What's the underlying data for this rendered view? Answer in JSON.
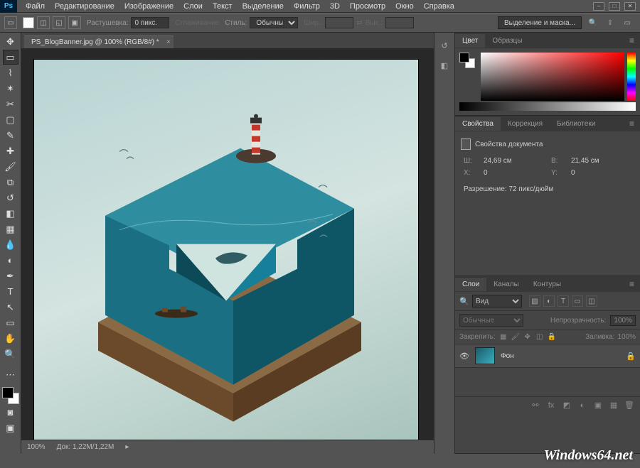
{
  "app": {
    "logo": "Ps"
  },
  "menu": [
    "Файл",
    "Редактирование",
    "Изображение",
    "Слои",
    "Текст",
    "Выделение",
    "Фильтр",
    "3D",
    "Просмотр",
    "Окно",
    "Справка"
  ],
  "window_ctrls": {
    "min": "–",
    "max": "□",
    "close": "✕"
  },
  "options": {
    "feather_label": "Растушевка:",
    "feather_value": "0 пикс.",
    "antialias_label": "Сглаживание",
    "style_label": "Стиль:",
    "style_value": "Обычный",
    "width_label": "Шир.:",
    "height_label": "Выс.:",
    "select_mask": "Выделение и маска..."
  },
  "document": {
    "tab_title": "PS_BlogBanner.jpg @ 100% (RGB/8#) *",
    "zoom": "100%",
    "doc_size": "Док: 1,22M/1,22M"
  },
  "panels": {
    "color": {
      "tabs": [
        "Цвет",
        "Образцы"
      ]
    },
    "properties": {
      "tabs": [
        "Свойства",
        "Коррекция",
        "Библиотеки"
      ],
      "title": "Свойства документа",
      "w_label": "Ш:",
      "w_value": "24,69 см",
      "h_label": "В:",
      "h_value": "21,45 см",
      "x_label": "X:",
      "x_value": "0",
      "y_label": "Y:",
      "y_value": "0",
      "res_label": "Разрешение:",
      "res_value": "72 пикс/дюйм"
    },
    "layers": {
      "tabs": [
        "Слои",
        "Каналы",
        "Контуры"
      ],
      "kind_label": "Вид",
      "blend_value": "Обычные",
      "opacity_label": "Непрозрачность:",
      "opacity_value": "100%",
      "lock_label": "Закрепить:",
      "fill_label": "Заливка:",
      "fill_value": "100%",
      "layer_name": "Фон"
    }
  },
  "watermark": "Windows64.net"
}
